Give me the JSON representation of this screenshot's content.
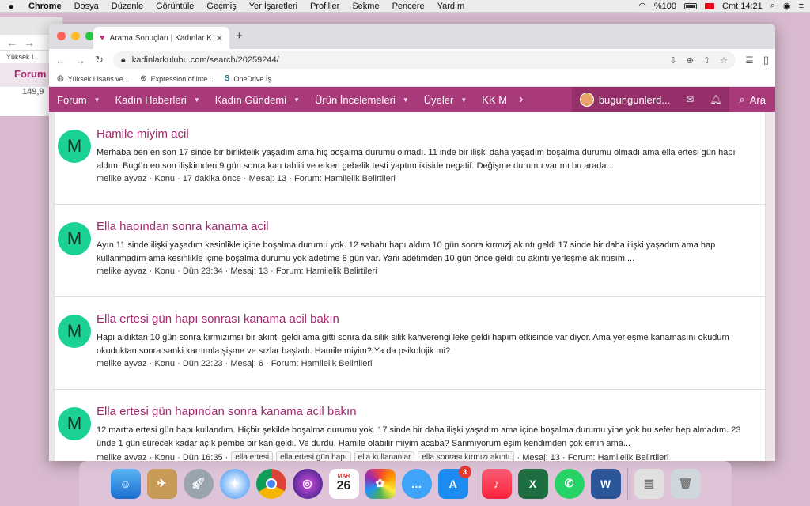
{
  "menubar": {
    "apple": "",
    "app": "Chrome",
    "items": [
      "Dosya",
      "Düzenle",
      "Görüntüle",
      "Geçmiş",
      "Yer İşaretleri",
      "Profiller",
      "Sekme",
      "Pencere",
      "Yardım"
    ],
    "battery": "%100",
    "datetime": "Cmt 14:21"
  },
  "bgwindow": {
    "bookmark": "Yüksek L",
    "tab": "Forum",
    "number": "149,9"
  },
  "tab": {
    "title": "Arama Sonuçları | Kadınlar Kulü",
    "close": "✕"
  },
  "toolbar": {
    "url": "kadinlarkulubu.com/search/20259244/"
  },
  "bookmarks": [
    {
      "label": "Yüksek Lisans ve..."
    },
    {
      "label": "Expression of inte..."
    },
    {
      "label": "OneDrive İş"
    }
  ],
  "nav": {
    "items": [
      "Forum",
      "Kadın Haberleri",
      "Kadın Gündemi",
      "Ürün İncelemeleri",
      "Üyeler",
      "KK M"
    ],
    "user": "bugungunlerd...",
    "search": "Ara"
  },
  "results": [
    {
      "avatar": "M",
      "title": "Hamile miyim acil",
      "snippet": "Merhaba ben en son 17 sinde bir birliktelik yaşadım ama hiç boşalma durumu olmadı. 11 inde bir ilişki daha yaşadım boşalma durumu olmadı ama ella ertesi gün hapı aldım. Bugün en son ilişkimden 9 gün sonra kan tahlili ve erken gebelik testi yaptım ikiside negatif. Değişme durumu var mı bu arada...",
      "meta": "melike ayvaz · Konu · 17 dakika önce · Mesaj: 13 · Forum: Hamilelik Belirtileri"
    },
    {
      "avatar": "M",
      "title": "Ella hapından sonra kanama acil",
      "snippet": "Ayın 11 sinde ilişki yaşadım kesinlikle içine boşalma durumu yok. 12 sabahı hapı aldım 10 gün sonra kırmızj akıntı geldi 17 sinde bir daha ilişki yaşadım ama hap kullanmadım ama kesinlikle içine boşalma durumu yok adetime 8 gün var. Yani adetimden 10 gün önce geldi bu akıntı yerleşme akıntısımı...",
      "meta": "melike ayvaz · Konu · Dün 23:34 · Mesaj: 13 · Forum: Hamilelik Belirtileri"
    },
    {
      "avatar": "M",
      "title": "Ella ertesi gün hapı sonrası kanama acil bakın",
      "snippet": "Hapı aldıktan 10 gün sonra kırmızımsı bir akıntı geldi ama gitti sonra da silik silik kahverengi leke geldi hapım etkisinde var diyor. Ama yerleşme kanamasını okudum okuduktan sonra sanki karnımla şişme ve sızlar başladı. Hamile miyim? Ya da psikolojik mi?",
      "meta": "melike ayvaz · Konu · Dün 22:23 · Mesaj: 6 · Forum: Hamilelik Belirtileri"
    },
    {
      "avatar": "M",
      "title": "Ella ertesi gün hapından sonra kanama acil bakın",
      "snippet": "12 martta ertesi gün hapı kullandım. Hiçbir şekilde boşalma durumu yok. 17 sinde bir daha ilişki yaşadım ama içine boşalma durumu yine yok bu sefer hep almadım. 23 ünde 1 gün sürecek kadar açık pembe bir kan geldi. Ve durdu. Hamile olabilir miyim acaba? Sanmıyorum eşim kendimden çok emin ama...",
      "meta_prefix": "melike ayvaz · Konu · Dün 16:35 ·",
      "tags": [
        "ella ertesi",
        "ella ertesi gün hapı",
        "ella kullananlar",
        "ella sonrası kırmızı akıntı"
      ],
      "meta_suffix": "· Mesaj: 13 · Forum: Hamilelik Belirtileri"
    }
  ],
  "dock": {
    "calendar_month": "MAR",
    "calendar_day": "26",
    "appstore_badge": "3"
  }
}
